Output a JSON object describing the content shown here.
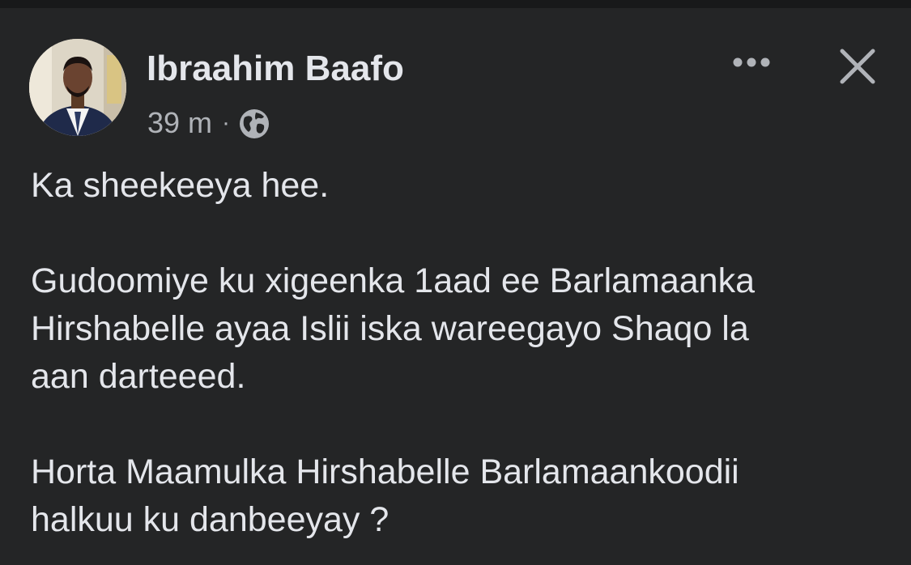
{
  "post": {
    "author": {
      "name": "Ibraahim Baafo",
      "avatar_icon": "profile-photo"
    },
    "meta": {
      "time": "39 m",
      "separator": "·",
      "audience_icon": "globe-icon"
    },
    "actions": {
      "more_icon": "ellipsis-icon",
      "close_icon": "close-icon"
    },
    "text": {
      "p1": [
        "Ka sheekeeya hee."
      ],
      "p2": [
        "Gudoomiye ku xigeenka 1aad ee Barlamaanka",
        "Hirshabelle ayaa Islii iska wareegayo Shaqo la",
        "aan darteeed."
      ],
      "p3": [
        "Horta Maamulka Hirshabelle Barlamaankoodii",
        "halkuu ku danbeeyay ?"
      ]
    }
  },
  "colors": {
    "background": "#242526",
    "text_primary": "#e4e6eb",
    "text_secondary": "#b0b3b8"
  }
}
